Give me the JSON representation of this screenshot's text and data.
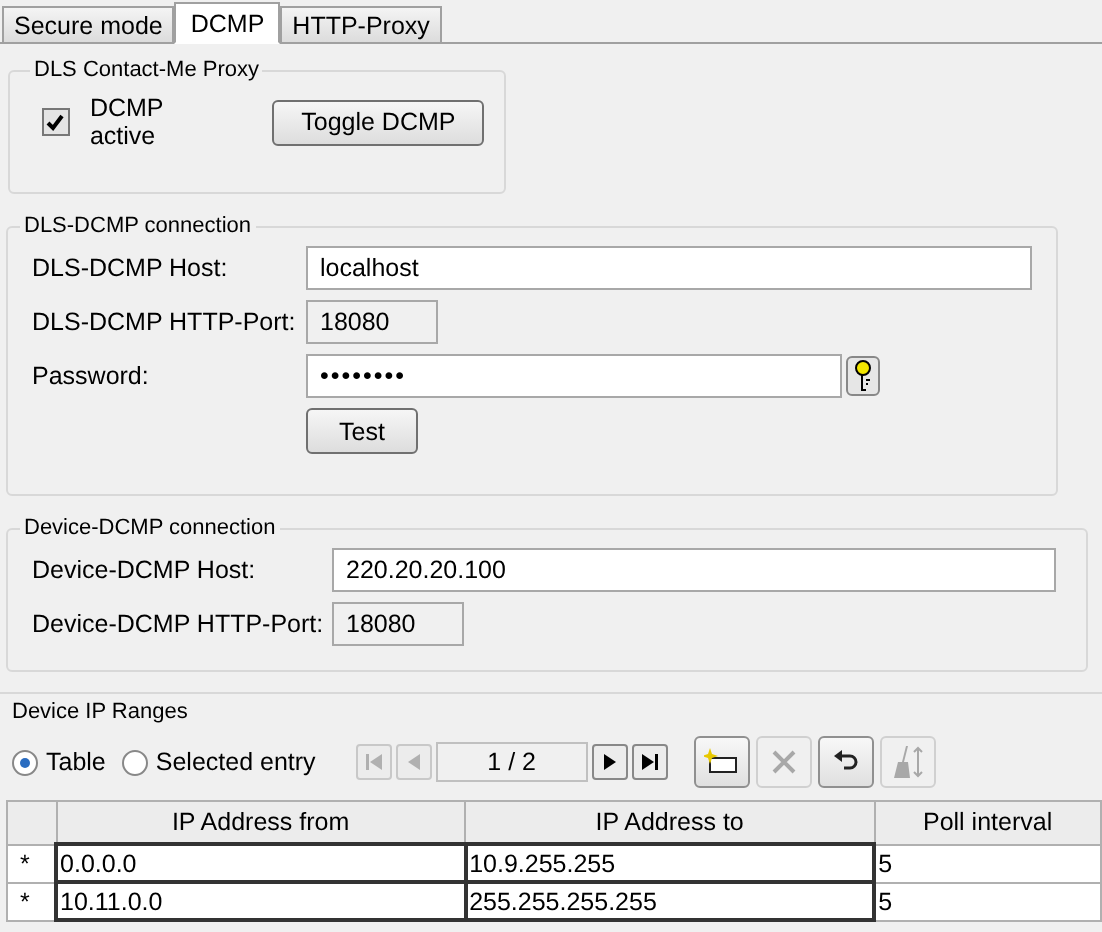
{
  "tabs": [
    {
      "label": "Secure mode",
      "selected": false
    },
    {
      "label": "DCMP",
      "selected": true
    },
    {
      "label": "HTTP-Proxy",
      "selected": false
    }
  ],
  "contact_me_proxy": {
    "title": "DLS Contact-Me Proxy",
    "dcmp_active": {
      "label": "DCMP active",
      "checked": true
    },
    "toggle_button": "Toggle DCMP"
  },
  "dls_dcmp_connection": {
    "title": "DLS-DCMP connection",
    "fields": [
      {
        "kind": "text",
        "label": "DLS-DCMP Host:",
        "value": "localhost"
      },
      {
        "kind": "short",
        "label": "DLS-DCMP HTTP-Port:",
        "value": "18080"
      },
      {
        "kind": "password",
        "label": "Password:",
        "value": "••••••••"
      }
    ],
    "test_button": "Test"
  },
  "device_dcmp_connection": {
    "title": "Device-DCMP connection",
    "fields": [
      {
        "kind": "text",
        "label": "Device-DCMP Host:",
        "value": "220.20.20.100"
      },
      {
        "kind": "short",
        "label": "Device-DCMP HTTP-Port:",
        "value": "18080"
      }
    ]
  },
  "device_ip_ranges": {
    "title": "Device IP Ranges",
    "view_options": [
      {
        "label": "Table",
        "selected": true
      },
      {
        "label": "Selected entry",
        "selected": false
      }
    ],
    "pager": {
      "page": "1 / 2",
      "first_disabled": true,
      "prev_disabled": true,
      "next_disabled": false,
      "last_disabled": false
    },
    "actions": [
      {
        "kind": "new",
        "disabled": false
      },
      {
        "kind": "delete",
        "disabled": true
      },
      {
        "kind": "undo",
        "disabled": false
      },
      {
        "kind": "clean",
        "disabled": true
      }
    ],
    "table": {
      "columns": [
        "IP Address from",
        "IP Address to",
        "Poll interval"
      ],
      "rows": [
        {
          "marker": "*",
          "cells": [
            "0.0.0.0",
            "10.9.255.255",
            "5"
          ]
        },
        {
          "marker": "*",
          "cells": [
            "10.11.0.0",
            "255.255.255.255",
            "5"
          ]
        }
      ]
    }
  }
}
